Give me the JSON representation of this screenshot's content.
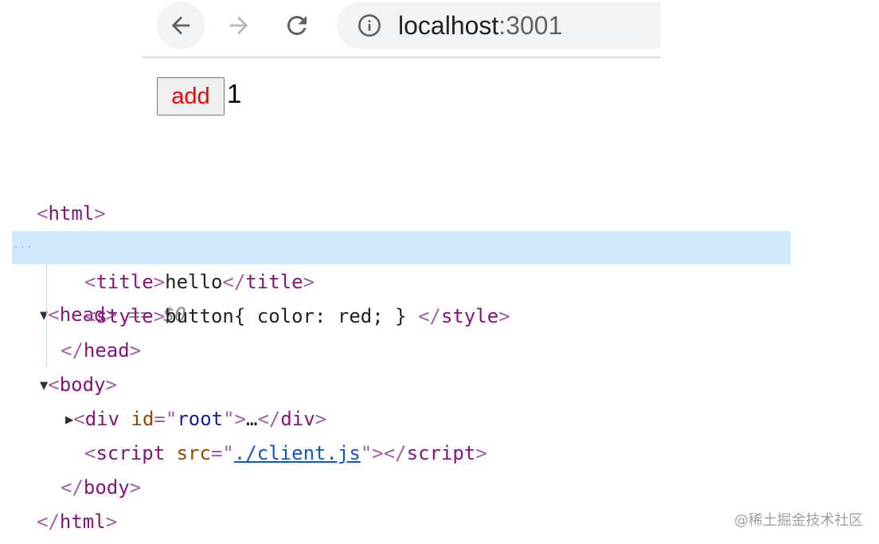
{
  "browser": {
    "url_host": "localhost",
    "url_port": ":3001",
    "icons": [
      "back-arrow-icon",
      "forward-arrow-icon",
      "reload-icon",
      "info-icon"
    ]
  },
  "page": {
    "button_label": "add",
    "counter_value": "1",
    "button_text_color": "#ff0000"
  },
  "elements_panel": {
    "html_open": "html",
    "head_tag": "head",
    "selection_marker": "== $0",
    "title_tag": "title",
    "title_text": "hello",
    "style_tag": "style",
    "style_text": "button{ color: red; } ",
    "body_tag": "body",
    "div_tag": "div",
    "div_attr_name": "id",
    "div_attr_value": "root",
    "div_ellipsis": "…",
    "script_tag": "script",
    "script_attr_name": "src",
    "script_attr_value": "./client.js"
  },
  "watermark": "@稀土掘金技术社区"
}
